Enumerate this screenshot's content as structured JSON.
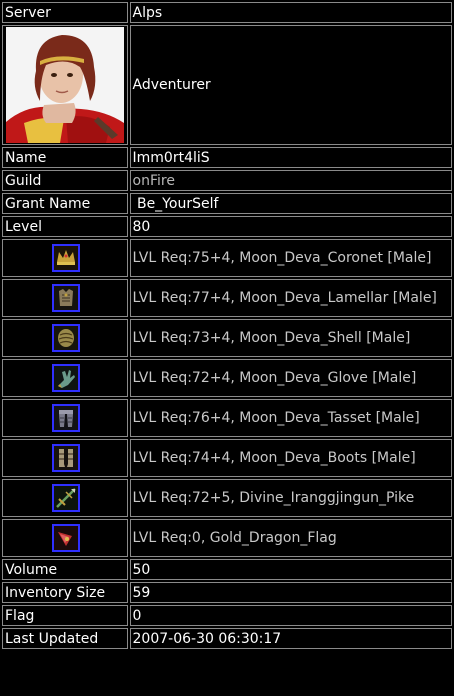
{
  "server": {
    "label": "Server",
    "value": "Alps"
  },
  "portrait": {
    "icon": "character-portrait",
    "class_text": "Adventurer"
  },
  "name": {
    "label": "Name",
    "value": "Imm0rt4liS"
  },
  "guild": {
    "label": "Guild",
    "value": "onFire"
  },
  "grant_name": {
    "label": "Grant Name",
    "value": " Be_YourSelf"
  },
  "level": {
    "label": "Level",
    "value": "80"
  },
  "equipment": [
    {
      "icon": "coronet-icon",
      "text": "LVL Req:75+4, Moon_Deva_Coronet [Male]",
      "color": "#c9a23a"
    },
    {
      "icon": "lamellar-armor-icon",
      "text": "LVL Req:77+4, Moon_Deva_Lamellar [Male]",
      "color": "#8a7a5a"
    },
    {
      "icon": "shell-armor-icon",
      "text": "LVL Req:73+4, Moon_Deva_Shell [Male]",
      "color": "#9a8a4a"
    },
    {
      "icon": "glove-icon",
      "text": "LVL Req:72+4, Moon_Deva_Glove [Male]",
      "color": "#6a9a8a"
    },
    {
      "icon": "tasset-icon",
      "text": "LVL Req:76+4, Moon_Deva_Tasset [Male]",
      "color": "#9a9aaa"
    },
    {
      "icon": "boots-icon",
      "text": "LVL Req:74+4, Moon_Deva_Boots [Male]",
      "color": "#a89a7a"
    },
    {
      "icon": "pike-icon",
      "text": "LVL Req:72+5, Divine_Iranggjingun_Pike",
      "color": "#6aa060"
    },
    {
      "icon": "flag-icon",
      "text": "LVL Req:0, Gold_Dragon_Flag",
      "color": "#c03030"
    }
  ],
  "volume": {
    "label": "Volume",
    "value": "50"
  },
  "inventory_size": {
    "label": "Inventory Size",
    "value": "59"
  },
  "flag": {
    "label": "Flag",
    "value": "0"
  },
  "last_updated": {
    "label": "Last Updated",
    "value": "2007-06-30 06:30:17"
  }
}
